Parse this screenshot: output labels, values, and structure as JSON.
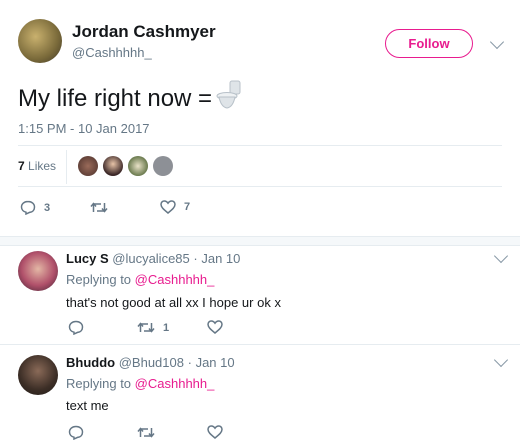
{
  "tweet": {
    "author_name": "Jordan Cashmyer",
    "author_handle": "@Cashhhhh_",
    "follow_label": "Follow",
    "text": "My life right now =",
    "timestamp": "1:15 PM - 10 Jan 2017",
    "likes_count": "7",
    "likes_label": "Likes",
    "replies_count": "3",
    "likes_action_count": "7",
    "toilet_icon": "toilet-emoji"
  },
  "replies": [
    {
      "name": "Lucy S",
      "handle": "@lucyalice85",
      "separator": "·",
      "date": "Jan 10",
      "replying_prefix": "Replying to",
      "replying_handle": "@Cashhhhh_",
      "text": "that's not good at all xx I hope ur ok x",
      "retweets": "1"
    },
    {
      "name": "Bhuddo",
      "handle": "@Bhud108",
      "separator": "·",
      "date": "Jan 10",
      "replying_prefix": "Replying to",
      "replying_handle": "@Cashhhhh_",
      "text": "text me"
    }
  ],
  "colors": {
    "accent": "#e81c8f",
    "muted": "#657786",
    "divider": "#e6ecf0"
  }
}
